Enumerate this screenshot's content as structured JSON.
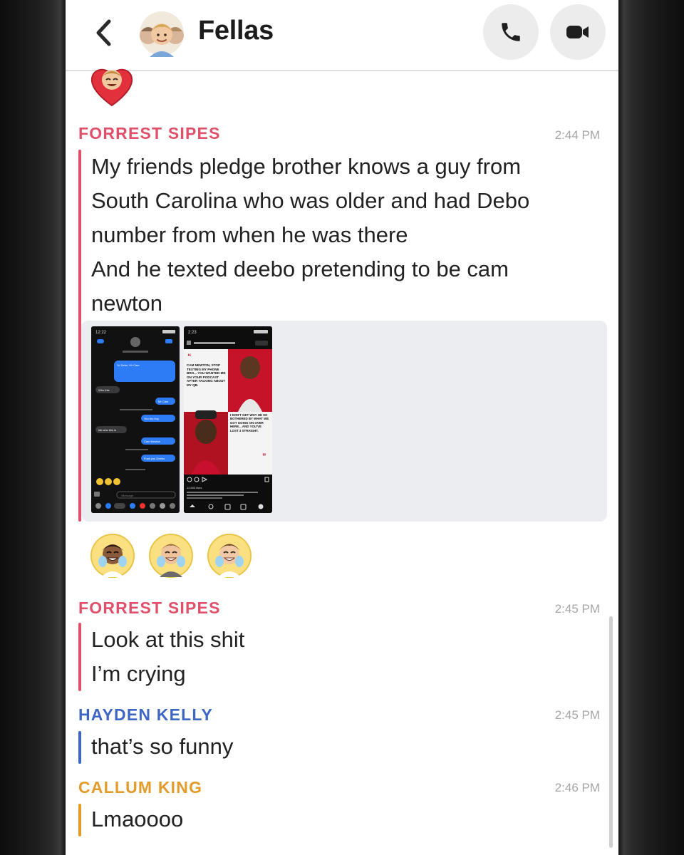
{
  "header": {
    "title": "Fellas",
    "back_icon": "chevron-left-icon",
    "call_icon": "phone-icon",
    "video_icon": "video-camera-icon"
  },
  "colors": {
    "forrest": "#e0506a",
    "hayden": "#3e66c4",
    "callum": "#e39b2a",
    "timestamp": "#a6a6a6"
  },
  "messages": [
    {
      "sender": "FORREST SIPES",
      "time": "2:44 PM",
      "lines": [
        "My friends pledge brother knows a guy from",
        "South Carolina who was older and had Debo",
        "number from when he was there",
        "And he texted deebo pretending to be cam",
        "newton"
      ]
    },
    {
      "sender": "FORREST SIPES",
      "time": "2:45 PM",
      "lines": [
        "Look at this shit",
        "I’m crying"
      ]
    },
    {
      "sender": "HAYDEN KELLY",
      "time": "2:45 PM",
      "lines": [
        "that’s so funny"
      ]
    },
    {
      "sender": "CALLUM KING",
      "time": "2:46 PM",
      "lines": [
        "Lmaoooo"
      ]
    }
  ],
  "attachment": {
    "screenshot1": {
      "status_time": "12:22",
      "chat_bubbles": [
        "Yo Debo, Mr Cam",
        "Who this",
        "Mr Cam",
        "You trip boy",
        "Idk who this is",
        "Cam Newton",
        "Fuck you Deebo"
      ],
      "input_placeholder": "iMessage"
    },
    "screenshot2": {
      "status_time": "2:23",
      "headline1": "CAM NEWTON, STOP TEXTING MY PHONE BRO... YOU WANTED ME ON YOUR PODCAST AFTER TALKING ABOUT MY QB.",
      "headline2": "I DON'T GET WHY HE SO BOTHERED BY WHAT WE GOT GOING ON OVER HERE... AND YOU'VE LOST 3 STRAIGHT.",
      "likes": "12,603 likes"
    }
  }
}
